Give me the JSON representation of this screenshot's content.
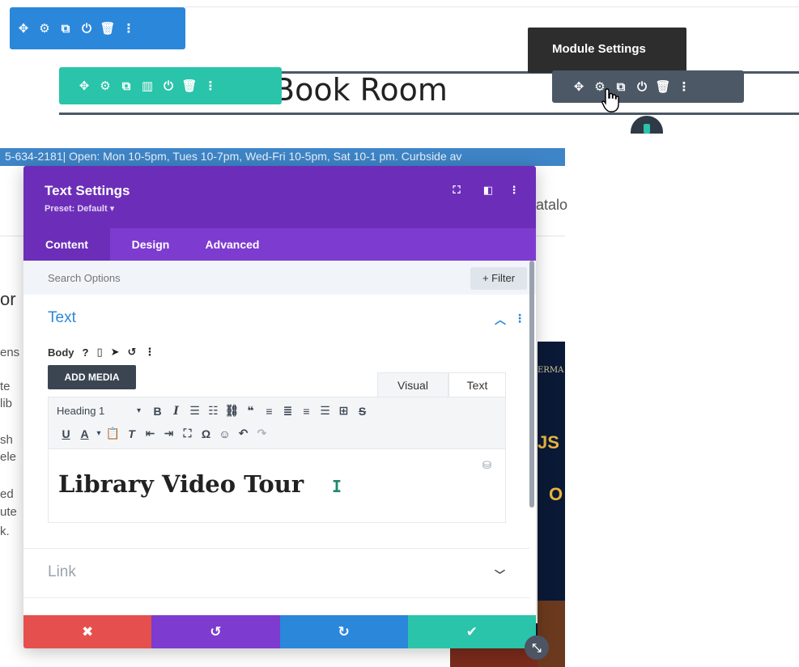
{
  "row_toolbar": {
    "icons": [
      "move-icon",
      "gear-icon",
      "duplicate-icon",
      "power-icon",
      "trash-icon",
      "more-icon"
    ]
  },
  "section_toolbar": {
    "icons": [
      "move-icon",
      "gear-icon",
      "duplicate-icon",
      "columns-icon",
      "power-icon",
      "trash-icon",
      "more-icon"
    ]
  },
  "module_toolbar": {
    "icons": [
      "move-icon",
      "gear-icon",
      "duplicate-icon",
      "power-icon",
      "trash-icon",
      "more-icon"
    ]
  },
  "tooltip": {
    "text": "Module Settings"
  },
  "page": {
    "heading": "Book Room",
    "info_strip": "5-634-2181| Open: Mon 10-5pm, Tues 10-7pm, Wed-Fri 10-5pm, Sat 10-1 pm. Curbside av",
    "catalog_fragment": "atalo",
    "left_fragments": [
      "or",
      "ens",
      "te",
      "lib",
      "sh",
      "ele",
      "ed",
      "ute",
      "k."
    ],
    "cover_fragments": [
      "ERMA",
      "JS",
      "O"
    ]
  },
  "modal": {
    "title": "Text Settings",
    "preset": "Preset: Default ▾",
    "tabs": [
      {
        "label": "Content",
        "active": true
      },
      {
        "label": "Design",
        "active": false
      },
      {
        "label": "Advanced",
        "active": false
      }
    ],
    "search_placeholder": "Search Options",
    "filter_label": "+ Filter",
    "text_section": {
      "title": "Text",
      "body_label": "Body",
      "add_media": "ADD MEDIA",
      "editor_tabs": {
        "visual": "Visual",
        "text": "Text"
      },
      "format_select": "Heading 1",
      "content": "Library Video Tour"
    },
    "link_section": {
      "title": "Link"
    }
  },
  "colors": {
    "row_blue": "#2b87da",
    "section_green": "#29c4a9",
    "module_gray": "#4c5866",
    "modal_purple": "#6c2eb9",
    "tabs_purple": "#7e3bd0",
    "cancel_red": "#e5504e",
    "redo_blue": "#2b87da",
    "save_green": "#29c4a9"
  }
}
